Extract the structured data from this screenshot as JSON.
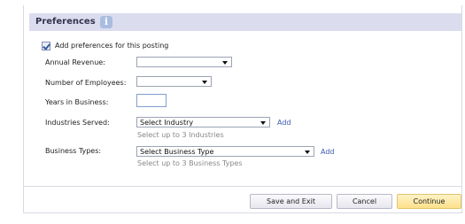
{
  "header": {
    "title": "Preferences",
    "info_icon": "info-icon"
  },
  "checkbox": {
    "label": "Add preferences for this posting",
    "checked": true
  },
  "fields": {
    "annual_revenue": {
      "label": "Annual Revenue:",
      "value": ""
    },
    "employees": {
      "label": "Number of Employees:",
      "value": ""
    },
    "years": {
      "label": "Years in Business:",
      "value": ""
    },
    "industries": {
      "label": "Industries Served:",
      "value": "Select Industry",
      "add": "Add",
      "hint": "Select up to 3 Industries"
    },
    "business_types": {
      "label": "Business Types:",
      "value": "Select Business Type",
      "add": "Add",
      "hint": "Select up to 3 Business Types"
    }
  },
  "buttons": {
    "save_exit": "Save and Exit",
    "cancel": "Cancel",
    "continue": "Continue"
  }
}
